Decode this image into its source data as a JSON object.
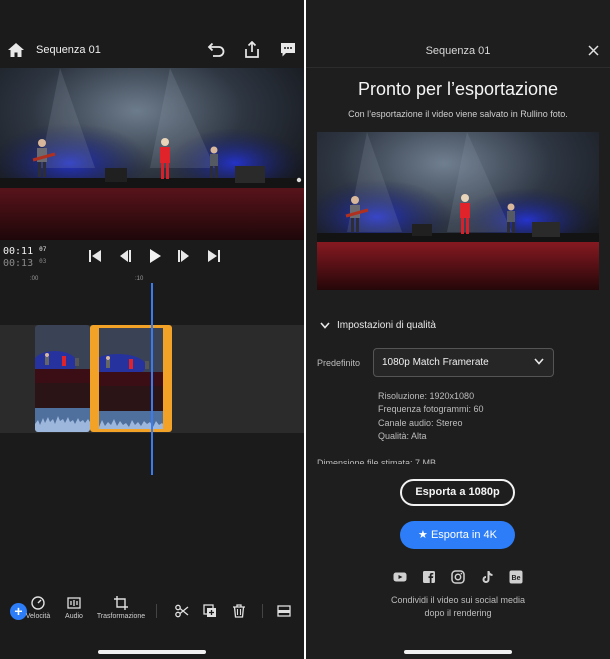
{
  "colors": {
    "accent_blue": "#2c7df7",
    "selection_orange": "#f2a227",
    "playhead_blue": "#3a7bf0",
    "panel_bg": "#1b1b1b"
  },
  "editor": {
    "header": {
      "title": "Sequenza 01",
      "icons": [
        "home-icon",
        "undo-icon",
        "share-icon",
        "comment-icon"
      ]
    },
    "timecode": {
      "current": "00:11",
      "current_frames": "07",
      "total": "00:13",
      "total_frames": "03"
    },
    "transport_icons": [
      "skip-to-start-icon",
      "step-back-icon",
      "play-icon",
      "step-forward-icon",
      "skip-to-end-icon"
    ],
    "ruler": {
      "mark_0": ":00",
      "mark_10": ":10"
    },
    "toolbar": {
      "speed_label": "Velocità",
      "audio_label": "Audio",
      "transform_label": "Trasformazione",
      "icons": [
        "add-icon",
        "speed-icon",
        "audio-icon",
        "transform-icon",
        "cut-icon",
        "duplicate-icon",
        "trash-icon",
        "more-icon"
      ]
    }
  },
  "export": {
    "header_title": "Sequenza 01",
    "heading": "Pronto per l’esportazione",
    "subheading": "Con l’esportazione il video viene salvato in Rullino foto.",
    "quality_section": "Impostazioni di qualità",
    "preset_label": "Predefinito",
    "preset_value": "1080p Match Framerate",
    "specs": {
      "resolution": "Risoluzione: 1920x1080",
      "framerate": "Frequenza fotogrammi: 60",
      "audio_channel": "Canale audio: Stereo",
      "quality": "Qualità: Alta"
    },
    "file_size": "Dimensione file stimata: 7 MB",
    "export_1080_button": "Esporta a 1080p",
    "export_4k_button": "Esporta in 4K",
    "export_4k_icon": "star-icon",
    "social_icons": [
      "youtube-icon",
      "facebook-icon",
      "instagram-icon",
      "tiktok-icon",
      "behance-icon"
    ],
    "share_line1": "Condividi il video sui social media",
    "share_line2": "dopo il rendering"
  }
}
